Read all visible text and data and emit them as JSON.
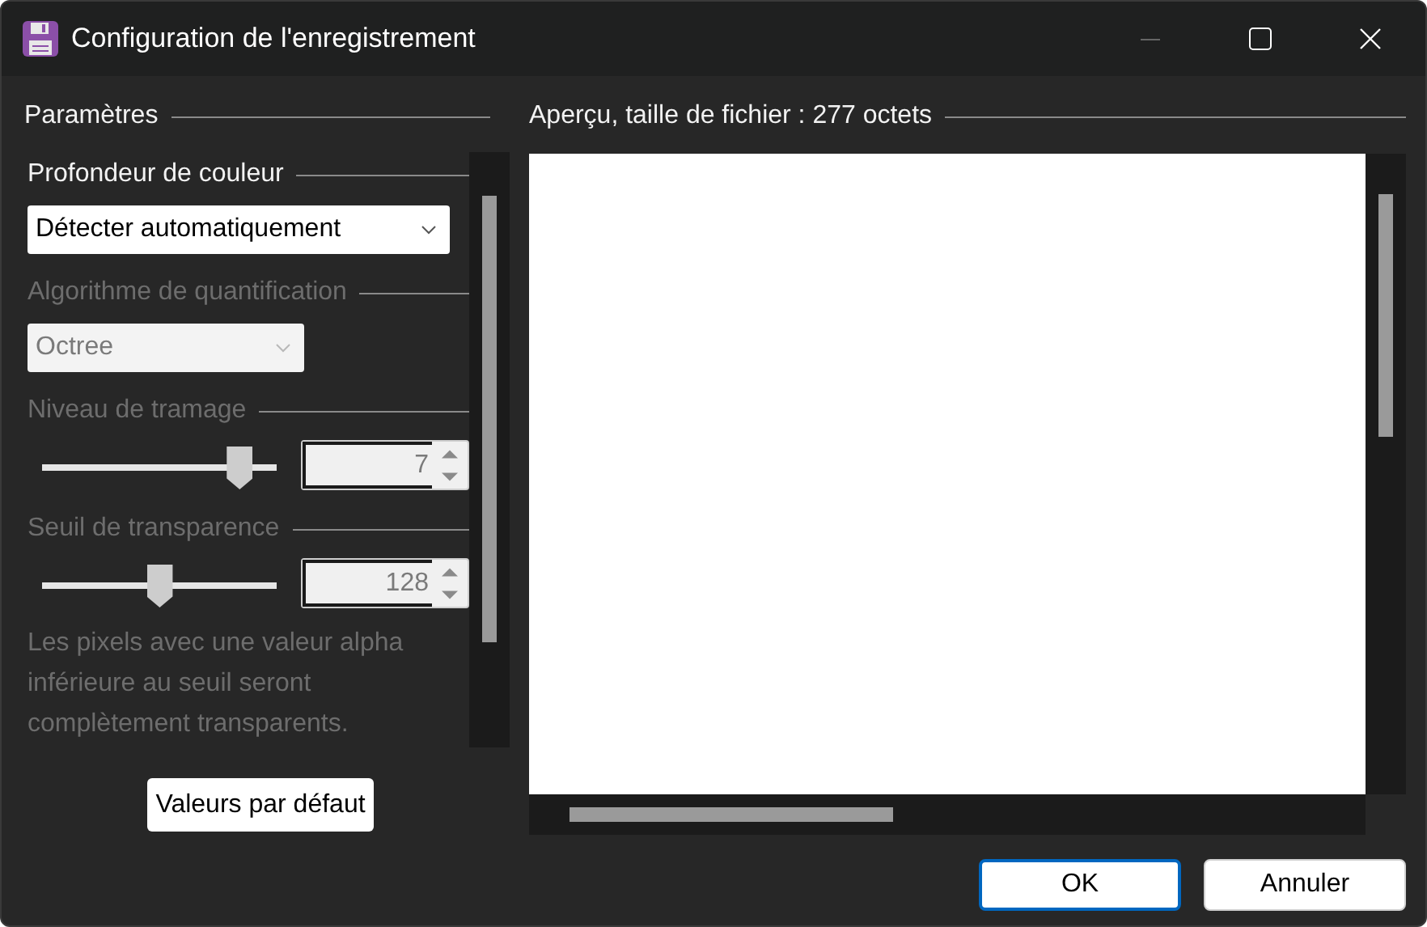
{
  "window": {
    "title": "Configuration de l'enregistrement"
  },
  "settings": {
    "title": "Paramètres",
    "sections": [
      {
        "kind": "dropdown",
        "label": "Profondeur de couleur",
        "disabled": false,
        "value": "Détecter automatiquement"
      },
      {
        "kind": "dropdown",
        "label": "Algorithme de quantification",
        "disabled": true,
        "value": "Octree"
      },
      {
        "kind": "slider",
        "label": "Niveau de tramage",
        "disabled": true,
        "level": 0.84,
        "value": "7"
      },
      {
        "kind": "slider",
        "label": "Seuil de transparence",
        "disabled": true,
        "level": 0.5,
        "value": "128",
        "note": "Les pixels avec une valeur alpha inférieure au seuil seront complètement transparents."
      }
    ],
    "reset_button": "Valeurs par défaut"
  },
  "preview": {
    "title": "Aperçu, taille de fichier : 277 octets"
  },
  "buttons": [
    {
      "label": "OK",
      "default": true
    },
    {
      "label": "Annuler",
      "default": false
    }
  ]
}
